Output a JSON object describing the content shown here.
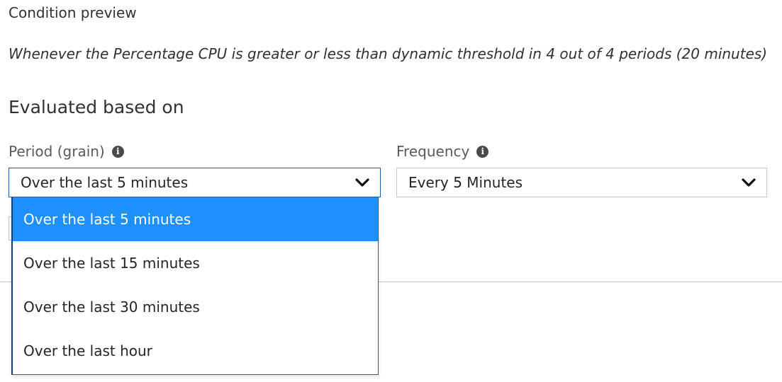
{
  "condition_preview": {
    "title": "Condition preview",
    "text": "Whenever the Percentage CPU is greater or less than dynamic threshold in 4 out of 4 periods (20 minutes)"
  },
  "evaluation": {
    "heading": "Evaluated based on",
    "period": {
      "label": "Period (grain)",
      "info_icon": "info-icon",
      "value": "Over the last 5 minutes",
      "chevron_icon": "chevron-down-icon",
      "options": [
        "Over the last 5 minutes",
        "Over the last 15 minutes",
        "Over the last 30 minutes",
        "Over the last hour"
      ],
      "selected_index": 0
    },
    "frequency": {
      "label": "Frequency",
      "info_icon": "info-icon",
      "value": "Every 5 Minutes",
      "chevron_icon": "chevron-down-icon"
    }
  },
  "colors": {
    "selected_option_bg": "#1e90ff",
    "open_select_border": "#1f5fa8",
    "text": "#252525",
    "muted_label": "#5a5a5a"
  }
}
